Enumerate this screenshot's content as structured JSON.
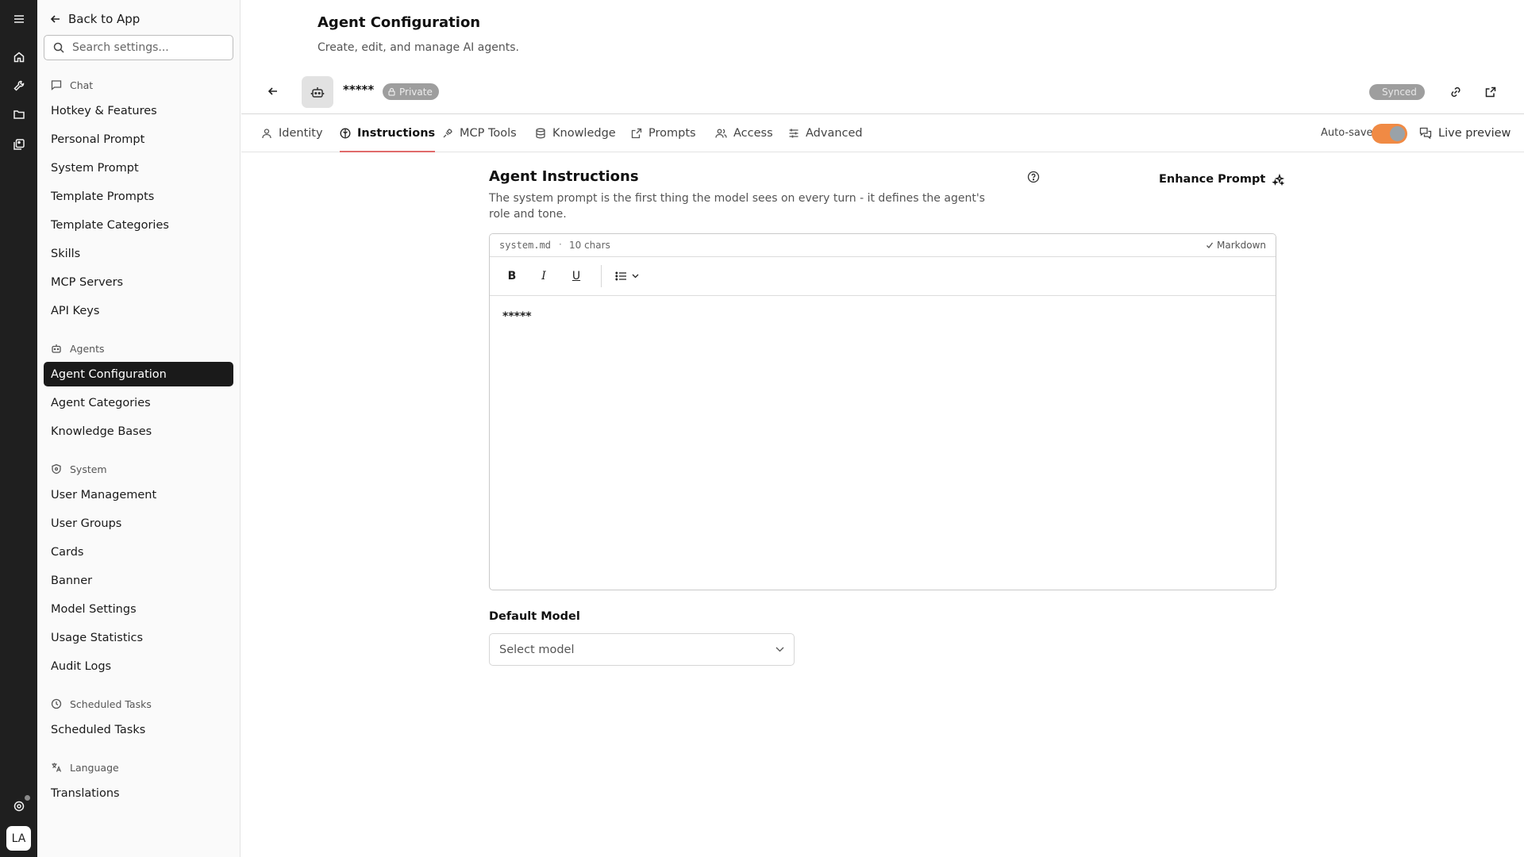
{
  "rail": {
    "avatar_initials": "LA"
  },
  "sidebar": {
    "back_label": "Back to App",
    "search_placeholder": "Search settings...",
    "groups": {
      "chat": "Chat",
      "agents": "Agents",
      "system": "System",
      "scheduled": "Scheduled Tasks",
      "language": "Language"
    },
    "items": {
      "hotkey": "Hotkey & Features",
      "personal_prompt": "Personal Prompt",
      "system_prompt": "System Prompt",
      "template_prompts": "Template Prompts",
      "template_categories": "Template Categories",
      "skills": "Skills",
      "mcp_servers": "MCP Servers",
      "api_keys": "API Keys",
      "agent_configuration": "Agent Configuration",
      "agent_categories": "Agent Categories",
      "knowledge_bases": "Knowledge Bases",
      "user_management": "User Management",
      "user_groups": "User Groups",
      "cards": "Cards",
      "banner": "Banner",
      "model_settings": "Model Settings",
      "usage_statistics": "Usage Statistics",
      "audit_logs": "Audit Logs",
      "scheduled_tasks": "Scheduled Tasks",
      "translations": "Translations"
    },
    "active_item": "Agent Configuration"
  },
  "header": {
    "title": "Agent Configuration",
    "subtitle": "Create, edit, and manage AI agents."
  },
  "agent": {
    "name": "*****",
    "visibility": "Private",
    "sync_status": "Synced"
  },
  "tabs": {
    "identity": "Identity",
    "instructions": "Instructions",
    "mcp_tools": "MCP Tools",
    "knowledge": "Knowledge",
    "prompts": "Prompts",
    "access": "Access",
    "advanced": "Advanced",
    "active": "Instructions"
  },
  "autosave": {
    "label": "Auto-save",
    "enabled": true
  },
  "live_preview_label": "Live preview",
  "instructions": {
    "title": "Agent Instructions",
    "description": "The system prompt is the first thing the model sees on every turn - it defines the agent's role and tone.",
    "enhance_label": "Enhance Prompt",
    "editor": {
      "filename": "system.md",
      "separator": "·",
      "char_count": "10 chars",
      "format": "Markdown",
      "content": "*****",
      "toolbar": {
        "bold": "B",
        "italic": "I",
        "underline": "U"
      }
    }
  },
  "default_model": {
    "label": "Default Model",
    "placeholder": "Select model"
  },
  "colors": {
    "rail_bg": "#1f1f1f",
    "active_nav_bg": "#1a1a1a",
    "tab_underline": "#e06b6b",
    "toggle_on": "#f08a44",
    "badge_gray": "#9e9e9e"
  }
}
